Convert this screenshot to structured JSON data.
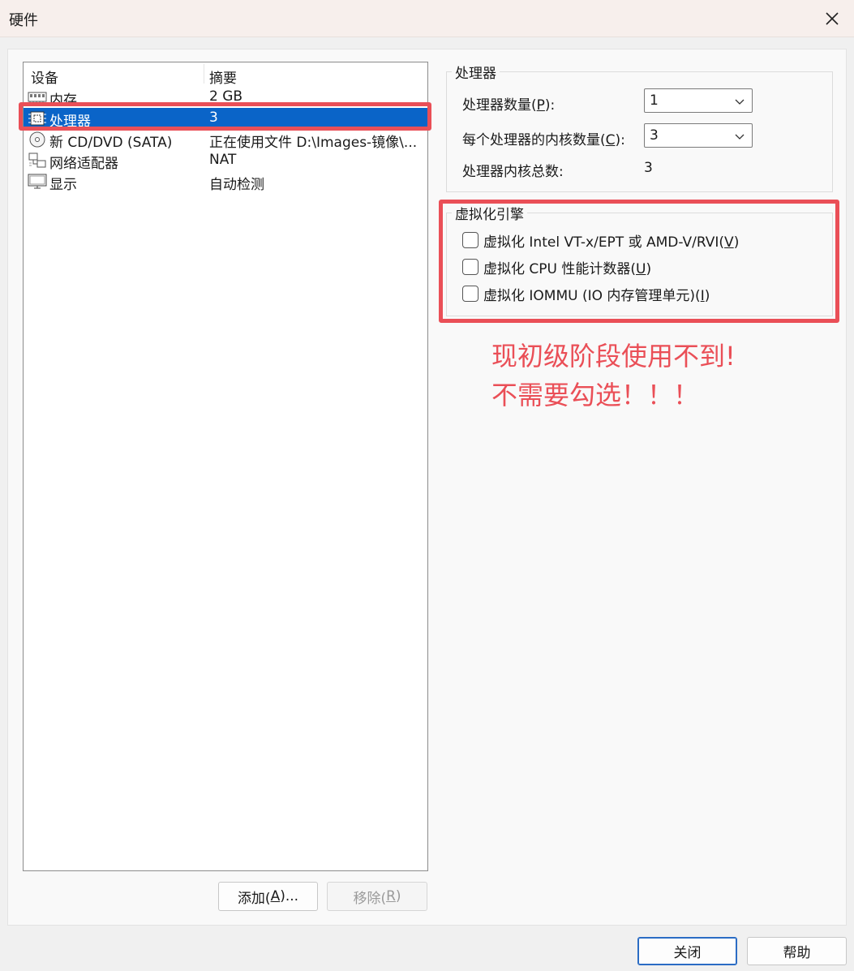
{
  "window": {
    "title": "硬件"
  },
  "device_list": {
    "columns": [
      "设备",
      "摘要"
    ],
    "rows": [
      {
        "icon": "memory-icon",
        "device": "内存",
        "summary": "2 GB"
      },
      {
        "icon": "processor-icon",
        "device": "处理器",
        "summary": "3",
        "selected": true
      },
      {
        "icon": "cd-dvd-icon",
        "device": "新 CD/DVD (SATA)",
        "summary": "正在使用文件 D:\\Images-镜像\\..."
      },
      {
        "icon": "network-adapter-icon",
        "device": "网络适配器",
        "summary": "NAT"
      },
      {
        "icon": "display-icon",
        "device": "显示",
        "summary": "自动检测"
      }
    ]
  },
  "buttons": {
    "add_pre": "添加(",
    "add_key": "A",
    "add_post": ")...",
    "remove_pre": "移除(",
    "remove_key": "R",
    "remove_post": ")",
    "close_label": "关闭",
    "help_label": "帮助"
  },
  "processor": {
    "legend": "处理器",
    "count_pre": "处理器数量(",
    "count_key": "P",
    "count_post": "):",
    "count_value": "1",
    "cores_pre": "每个处理器的内核数量(",
    "cores_key": "C",
    "cores_post": "):",
    "cores_value": "3",
    "total_label": "处理器内核总数:",
    "total_value": "3"
  },
  "virtualization": {
    "legend": "虚拟化引擎",
    "opt1_pre": "虚拟化 Intel VT-x/EPT 或 AMD-V/RVI(",
    "opt1_key": "V",
    "opt1_post": ")",
    "opt1_checked": false,
    "opt2_pre": "虚拟化 CPU 性能计数器(",
    "opt2_key": "U",
    "opt2_post": ")",
    "opt2_checked": false,
    "opt3_pre": "虚拟化 IOMMU (IO 内存管理单元)(",
    "opt3_key": "I",
    "opt3_post": ")",
    "opt3_checked": false
  },
  "annotation": {
    "line1": "现初级阶段使用不到!",
    "line2": "不需要勾选！！！"
  },
  "colors": {
    "selection": "#0a64c8",
    "annotation_red": "#ea4f57"
  }
}
